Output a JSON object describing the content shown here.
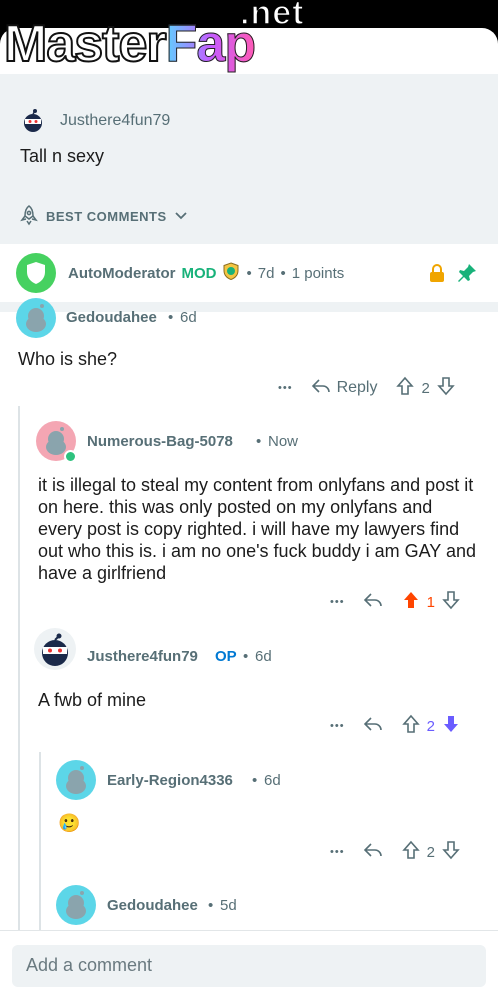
{
  "watermark": {
    "net": ".net",
    "master": "Master",
    "fap": "Fap"
  },
  "post": {
    "author": "Justhere4fun79",
    "text": "Tall n sexy"
  },
  "sort": {
    "label": "BEST COMMENTS"
  },
  "automod": {
    "author": "AutoModerator",
    "badge": "MOD",
    "dot1": "•",
    "time": "7d",
    "dot2": "•",
    "points": "1 points"
  },
  "comments": [
    {
      "author": "Gedoudahee",
      "dot": "•",
      "time": "6d",
      "text": "Who is she?",
      "more": "•••",
      "reply": "Reply",
      "score": "2"
    },
    {
      "author": "Numerous-Bag-5078",
      "dot": "•",
      "time": "Now",
      "text": "it is illegal to steal my content from onlyfans and post it on here. this was only posted on my onlyfans and every post is copy righted. i will have my lawyers find out who this is. i am no one's fuck buddy i am GAY and have  a girlfriend",
      "more": "•••",
      "score": "1"
    },
    {
      "author": "Justhere4fun79",
      "op": "OP",
      "dot": "•",
      "time": "6d",
      "text": "A fwb of mine",
      "more": "•••",
      "score": "2"
    },
    {
      "author": "Early-Region4336",
      "dot": "•",
      "time": "6d",
      "text": "🥲",
      "more": "•••",
      "score": "2"
    },
    {
      "author": "Gedoudahee",
      "dot": "•",
      "time": "5d"
    }
  ],
  "composer": {
    "placeholder": "Add a comment"
  },
  "colors": {
    "upvote_active": "#ff4500",
    "downvote_active": "#6a5cff",
    "mod_green": "#18b27a",
    "bg_muted": "#eef2f4"
  }
}
